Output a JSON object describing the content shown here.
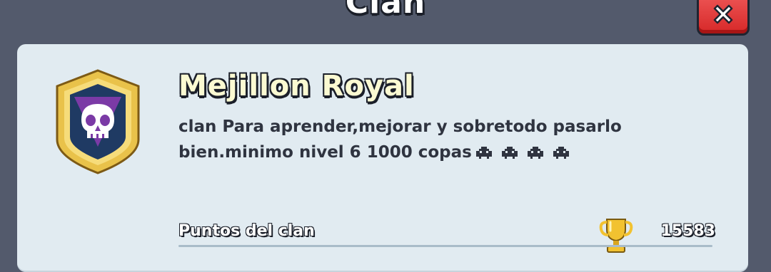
{
  "header": {
    "title": "Clan"
  },
  "clan": {
    "name": "Mejillon Royal",
    "description": "clan Para aprender,mejorar y sobretodo pasarlo bien.minimo nivel 6 1000 copas"
  },
  "stats": [
    {
      "label": "Puntos del clan",
      "value": "15583",
      "icon": "trophy-icon"
    }
  ],
  "icons": {
    "close": "close-icon",
    "badge": "skull-badge-icon",
    "emoji": "alien-monster-icon"
  }
}
